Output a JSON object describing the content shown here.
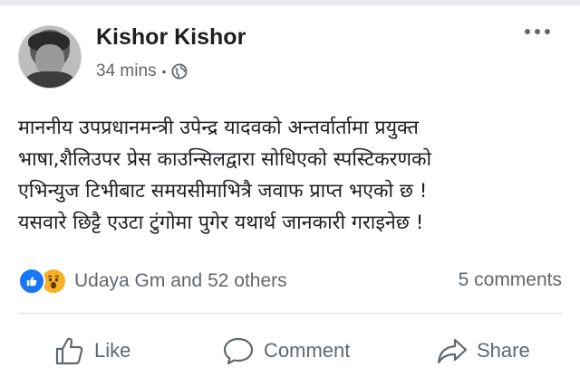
{
  "post": {
    "author": "Kishor Kishor",
    "time": "34 mins",
    "separator": "•",
    "more_icon": "more-horizontal-icon",
    "privacy_icon": "globe-icon",
    "body_lines": [
      "माननीय उपप्रधानमन्त्री उपेन्द्र यादवको अन्तर्वार्तामा प्रयुक्त",
      "भाषा,शैलिउपर प्रेस काउन्सिलद्वारा सोधिएको स्पस्टिकरणको",
      "एभिन्युज टिभीबाट समयसीमाभित्रै जवाफ प्राप्त भएको छ !",
      "यसवारे छिट्टै एउटा टुंगोमा पुगेर यथार्थ जानकारी गराइनेछ !"
    ]
  },
  "reactions": {
    "icons": [
      "like-reaction-icon",
      "wow-reaction-icon"
    ],
    "text": "Udaya Gm and 52 others",
    "comments": "5 comments"
  },
  "actions": {
    "like": "Like",
    "comment": "Comment",
    "share": "Share"
  },
  "colors": {
    "like_blue": "#1877f2",
    "wow_yellow": "#f7b125",
    "secondary_text": "#606770",
    "primary_text": "#1c1e21"
  }
}
